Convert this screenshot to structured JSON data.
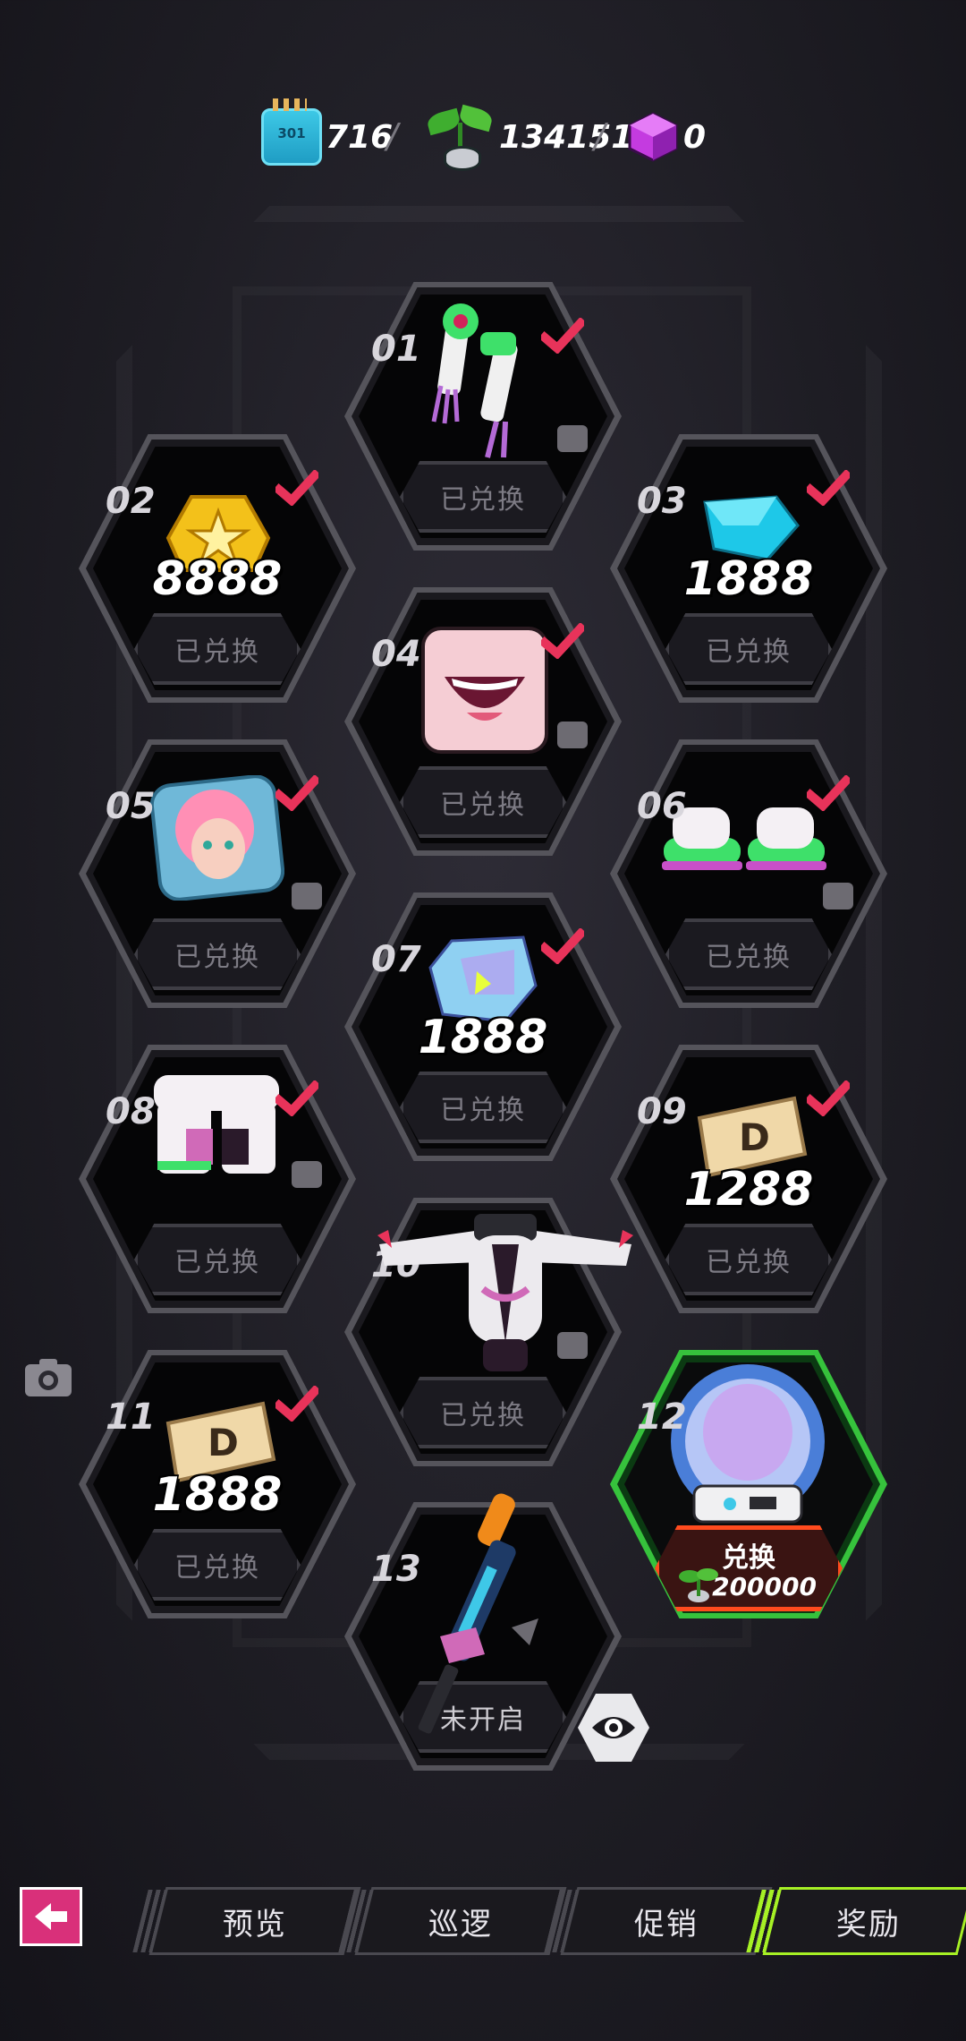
{
  "currencies": [
    {
      "name": "ticket",
      "icon": "ticket-icon",
      "label": "301",
      "value": "716"
    },
    {
      "name": "sprout",
      "icon": "sprout-icon",
      "value": "134151"
    },
    {
      "name": "cube",
      "icon": "cube-icon",
      "value": "0"
    }
  ],
  "separator": "/",
  "rewards": [
    {
      "num": "01",
      "status": "已兑换",
      "claimed": true,
      "amount": ""
    },
    {
      "num": "02",
      "status": "已兑换",
      "claimed": true,
      "amount": "8888"
    },
    {
      "num": "03",
      "status": "已兑换",
      "claimed": true,
      "amount": "1888"
    },
    {
      "num": "04",
      "status": "已兑换",
      "claimed": true,
      "amount": ""
    },
    {
      "num": "05",
      "status": "已兑换",
      "claimed": true,
      "amount": ""
    },
    {
      "num": "06",
      "status": "已兑换",
      "claimed": true,
      "amount": ""
    },
    {
      "num": "07",
      "status": "已兑换",
      "claimed": true,
      "amount": "1888"
    },
    {
      "num": "08",
      "status": "已兑换",
      "claimed": true,
      "amount": ""
    },
    {
      "num": "09",
      "status": "已兑换",
      "claimed": true,
      "amount": "1288"
    },
    {
      "num": "10",
      "status": "已兑换",
      "claimed": false,
      "amount": ""
    },
    {
      "num": "11",
      "status": "已兑换",
      "claimed": true,
      "amount": "1888"
    },
    {
      "num": "12",
      "exchange_label": "兑换",
      "cost": "200000"
    },
    {
      "num": "13",
      "status": "未开启",
      "claimed": false,
      "amount": ""
    }
  ],
  "nav": {
    "tabs": [
      "预览",
      "巡逻",
      "促销",
      "奖励"
    ],
    "active": "奖励"
  },
  "colors": {
    "accent_green": "#a6f025",
    "check_red": "#e8335a",
    "exchange_border": "#ff4b1e"
  }
}
